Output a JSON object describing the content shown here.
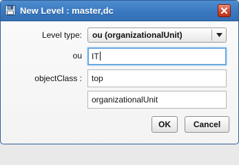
{
  "dialog": {
    "title": "New Level : master,dc",
    "icons": {
      "title": "floppy-disk-icon",
      "close": "close-x-icon"
    }
  },
  "form": {
    "level_type": {
      "label": "Level type:",
      "value": "ou (organizationalUnit)"
    },
    "ou": {
      "label": "ou",
      "value": "IT"
    },
    "objectclass": {
      "label": "objectClass :",
      "values": [
        "top",
        "organizationalUnit"
      ]
    }
  },
  "buttons": {
    "ok": "OK",
    "cancel": "Cancel"
  },
  "colors": {
    "titlebar": "#3a79c1",
    "close": "#cf4a2e",
    "focus": "#6aa9e0"
  }
}
